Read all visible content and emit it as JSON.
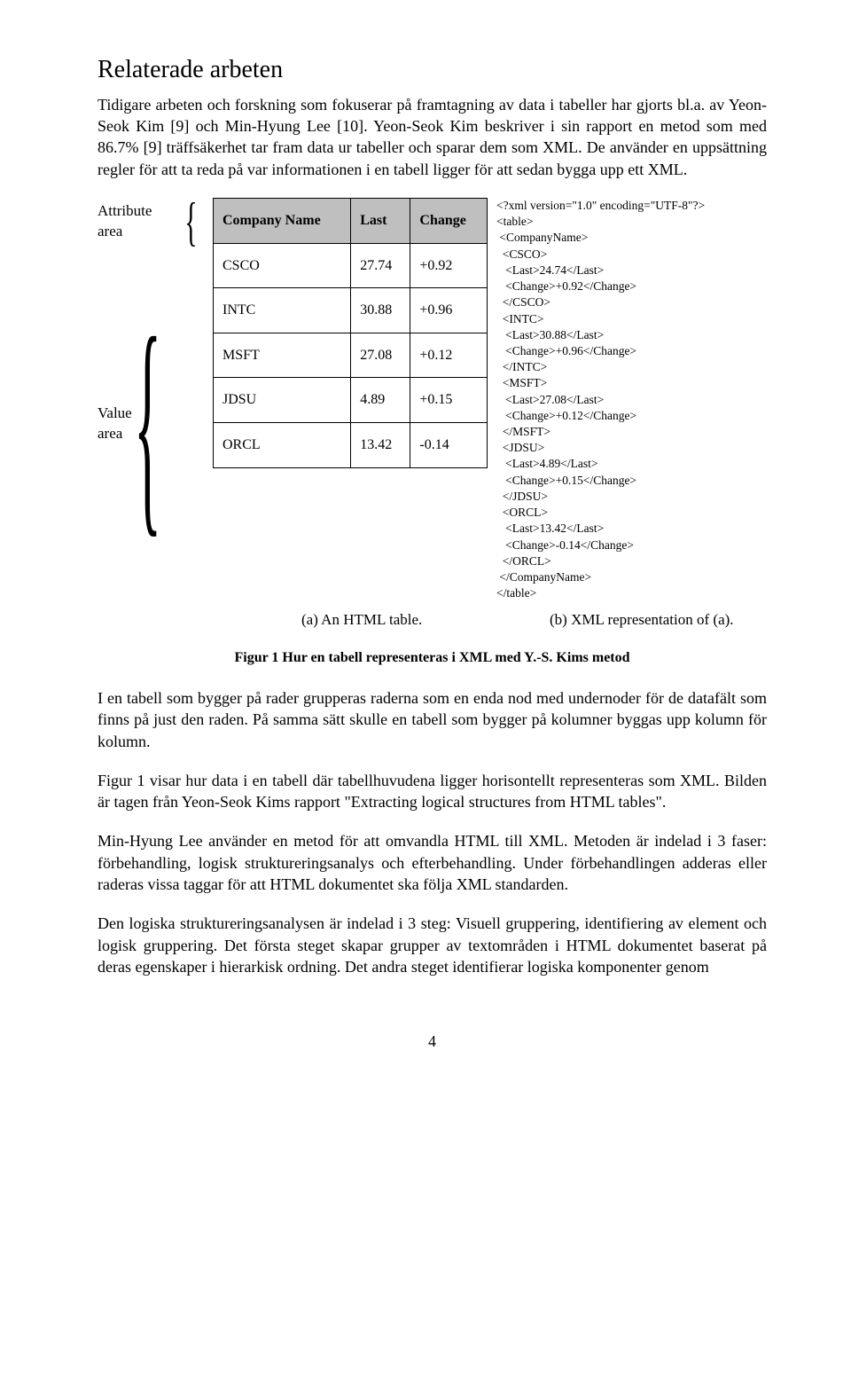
{
  "heading": "Relaterade arbeten",
  "para1": "Tidigare arbeten och forskning som fokuserar på framtagning av data i tabeller har gjorts bl.a. av Yeon-Seok Kim [9] och Min-Hyung Lee [10]. Yeon-Seok Kim beskriver i sin rapport en metod som med 86.7% [9] träffsäkerhet tar fram data ur tabeller och sparar dem som XML. De använder en uppsättning regler för att ta reda på var informationen i en tabell ligger för att sedan bygga upp ett XML.",
  "figure": {
    "attr_label": "Attribute area",
    "value_label": "Value area",
    "table": {
      "headers": [
        "Company Name",
        "Last",
        "Change"
      ],
      "rows": [
        [
          "CSCO",
          "27.74",
          "+0.92"
        ],
        [
          "INTC",
          "30.88",
          "+0.96"
        ],
        [
          "MSFT",
          "27.08",
          "+0.12"
        ],
        [
          "JDSU",
          "4.89",
          "+0.15"
        ],
        [
          "ORCL",
          "13.42",
          "-0.14"
        ]
      ]
    },
    "xml_lines": [
      "<?xml version=\"1.0\" encoding=\"UTF-8\"?>",
      "<table>",
      " <CompanyName>",
      "  <CSCO>",
      "   <Last>24.74</Last>",
      "   <Change>+0.92</Change>",
      "  </CSCO>",
      "  <INTC>",
      "   <Last>30.88</Last>",
      "   <Change>+0.96</Change>",
      "  </INTC>",
      "  <MSFT>",
      "   <Last>27.08</Last>",
      "   <Change>+0.12</Change>",
      "  </MSFT>",
      "  <JDSU>",
      "   <Last>4.89</Last>",
      "   <Change>+0.15</Change>",
      "  </JDSU>",
      "  <ORCL>",
      "   <Last>13.42</Last>",
      "   <Change>-0.14</Change>",
      "  </ORCL>",
      " </CompanyName>",
      "</table>"
    ],
    "cap_a": "(a) An HTML table.",
    "cap_b": "(b) XML representation of (a).",
    "caption": "Figur 1 Hur en tabell representeras i XML med Y.-S. Kims metod"
  },
  "para2": "I en tabell som bygger på rader grupperas raderna som en enda nod med undernoder för de datafält som finns på just den raden. På samma sätt skulle en tabell som bygger på kolumner byggas upp kolumn för kolumn.",
  "para3": "Figur 1 visar hur data i en tabell där tabellhuvudena ligger horisontellt representeras som XML. Bilden är tagen från Yeon-Seok Kims rapport \"Extracting logical structures from HTML tables\".",
  "para4": "Min-Hyung Lee använder en metod för att omvandla HTML till XML. Metoden är indelad i 3 faser: förbehandling, logisk struktureringsanalys och efterbehandling. Under förbehandlingen adderas eller raderas vissa taggar för att HTML dokumentet ska följa XML standarden.",
  "para5": "Den logiska struktureringsanalysen är indelad i 3 steg: Visuell gruppering, identifiering av element och logisk gruppering. Det första steget skapar grupper av textområden i HTML dokumentet baserat på deras egenskaper i hierarkisk ordning. Det andra steget identifierar logiska komponenter genom",
  "page_number": "4"
}
